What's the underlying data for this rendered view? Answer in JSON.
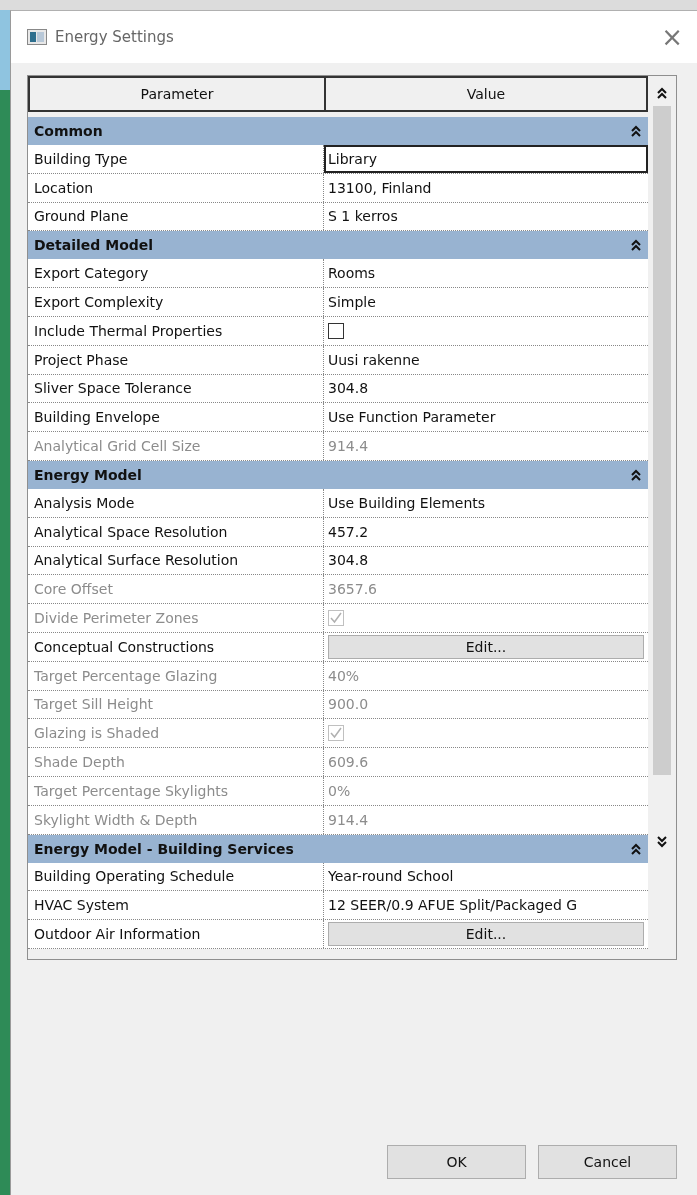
{
  "window": {
    "title": "Energy Settings",
    "close": "×"
  },
  "table": {
    "columns": [
      "Parameter",
      "Value"
    ],
    "sections": [
      {
        "title": "Common",
        "expanded": true,
        "rows": [
          {
            "kind": "text",
            "name": "Building Type",
            "value": "Library",
            "disabled": false,
            "selected": true
          },
          {
            "kind": "text",
            "name": "Location",
            "value": "13100, Finland",
            "disabled": false,
            "selected": false
          },
          {
            "kind": "text",
            "name": "Ground Plane",
            "value": "S 1 kerros",
            "disabled": false,
            "selected": false
          }
        ]
      },
      {
        "title": "Detailed Model",
        "expanded": true,
        "rows": [
          {
            "kind": "text",
            "name": "Export Category",
            "value": "Rooms",
            "disabled": false,
            "selected": false
          },
          {
            "kind": "text",
            "name": "Export Complexity",
            "value": "Simple",
            "disabled": false,
            "selected": false
          },
          {
            "kind": "checkbox",
            "name": "Include Thermal Properties",
            "checked": false,
            "disabled": false,
            "selected": false
          },
          {
            "kind": "text",
            "name": "Project Phase",
            "value": "Uusi rakenne",
            "disabled": false,
            "selected": false
          },
          {
            "kind": "text",
            "name": "Sliver Space Tolerance",
            "value": "304.8",
            "disabled": false,
            "selected": false
          },
          {
            "kind": "text",
            "name": "Building Envelope",
            "value": "Use Function Parameter",
            "disabled": false,
            "selected": false
          },
          {
            "kind": "text",
            "name": "Analytical Grid Cell Size",
            "value": "914.4",
            "disabled": true,
            "selected": false
          }
        ]
      },
      {
        "title": "Energy Model",
        "expanded": true,
        "rows": [
          {
            "kind": "text",
            "name": "Analysis Mode",
            "value": "Use Building Elements",
            "disabled": false,
            "selected": false
          },
          {
            "kind": "text",
            "name": "Analytical Space Resolution",
            "value": "457.2",
            "disabled": false,
            "selected": false
          },
          {
            "kind": "text",
            "name": "Analytical Surface Resolution",
            "value": "304.8",
            "disabled": false,
            "selected": false
          },
          {
            "kind": "text",
            "name": "Core Offset",
            "value": "3657.6",
            "disabled": true,
            "selected": false
          },
          {
            "kind": "checkbox",
            "name": "Divide Perimeter Zones",
            "checked": true,
            "disabled": true,
            "selected": false
          },
          {
            "kind": "button",
            "name": "Conceptual Constructions",
            "value": "Edit...",
            "disabled": false,
            "selected": false
          },
          {
            "kind": "text",
            "name": "Target Percentage Glazing",
            "value": "40%",
            "disabled": true,
            "selected": false
          },
          {
            "kind": "text",
            "name": "Target Sill Height",
            "value": "900.0",
            "disabled": true,
            "selected": false
          },
          {
            "kind": "checkbox",
            "name": "Glazing is Shaded",
            "checked": true,
            "disabled": true,
            "selected": false
          },
          {
            "kind": "text",
            "name": "Shade Depth",
            "value": "609.6",
            "disabled": true,
            "selected": false
          },
          {
            "kind": "text",
            "name": "Target Percentage Skylights",
            "value": "0%",
            "disabled": true,
            "selected": false
          },
          {
            "kind": "text",
            "name": "Skylight Width & Depth",
            "value": "914.4",
            "disabled": true,
            "selected": false
          }
        ]
      },
      {
        "title": "Energy Model - Building Services",
        "expanded": true,
        "rows": [
          {
            "kind": "text",
            "name": "Building Operating Schedule",
            "value": "Year-round School",
            "disabled": false,
            "selected": false
          },
          {
            "kind": "text",
            "name": "HVAC System",
            "value": "12 SEER/0.9 AFUE Split/Packaged G",
            "disabled": false,
            "selected": false
          },
          {
            "kind": "button",
            "name": "Outdoor Air Information",
            "value": "Edit...",
            "disabled": false,
            "selected": false
          }
        ]
      }
    ]
  },
  "buttons": [
    "OK",
    "Cancel"
  ]
}
